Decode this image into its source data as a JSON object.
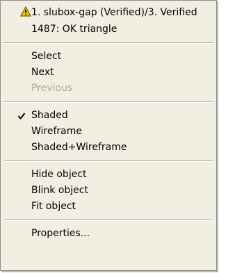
{
  "menu": {
    "header": {
      "title": "1. slubox-gap (Verified)/3. Verified",
      "subtitle": "1487: OK triangle",
      "icon": "warning-triangle-icon"
    },
    "nav": {
      "select": "Select",
      "next": "Next",
      "previous": "Previous"
    },
    "display": {
      "shaded": "Shaded",
      "wireframe": "Wireframe",
      "shaded_wireframe": "Shaded+Wireframe",
      "checked": "Shaded"
    },
    "object": {
      "hide": "Hide object",
      "blink": "Blink object",
      "fit": "Fit object"
    },
    "properties": "Properties..."
  },
  "colors": {
    "menu_bg": "#f1efe2",
    "disabled_text": "#aca899",
    "warning_fill": "#f5c400"
  }
}
